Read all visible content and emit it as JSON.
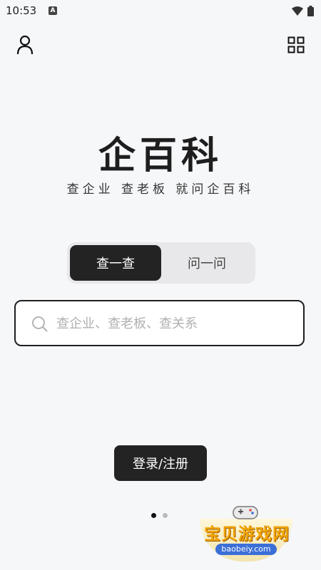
{
  "status_bar": {
    "time": "10:53",
    "badge": "A"
  },
  "header": {
    "user_icon": "user-icon",
    "grid_icon": "grid-icon"
  },
  "brand": {
    "title": "企百科",
    "tagline": "查企业 查老板 就问企百科"
  },
  "tabs": [
    {
      "label": "查一查",
      "active": true
    },
    {
      "label": "问一问",
      "active": false
    }
  ],
  "search": {
    "placeholder": "查企业、查老板、查关系",
    "value": ""
  },
  "login": {
    "label": "登录/注册"
  },
  "pager": {
    "count": 2,
    "active_index": 0
  },
  "watermark": {
    "title": "宝贝游戏网",
    "url": "baobeiy.com"
  },
  "colors": {
    "background": "#f6f7f9",
    "dark": "#232323",
    "accent": "#f2a400"
  }
}
